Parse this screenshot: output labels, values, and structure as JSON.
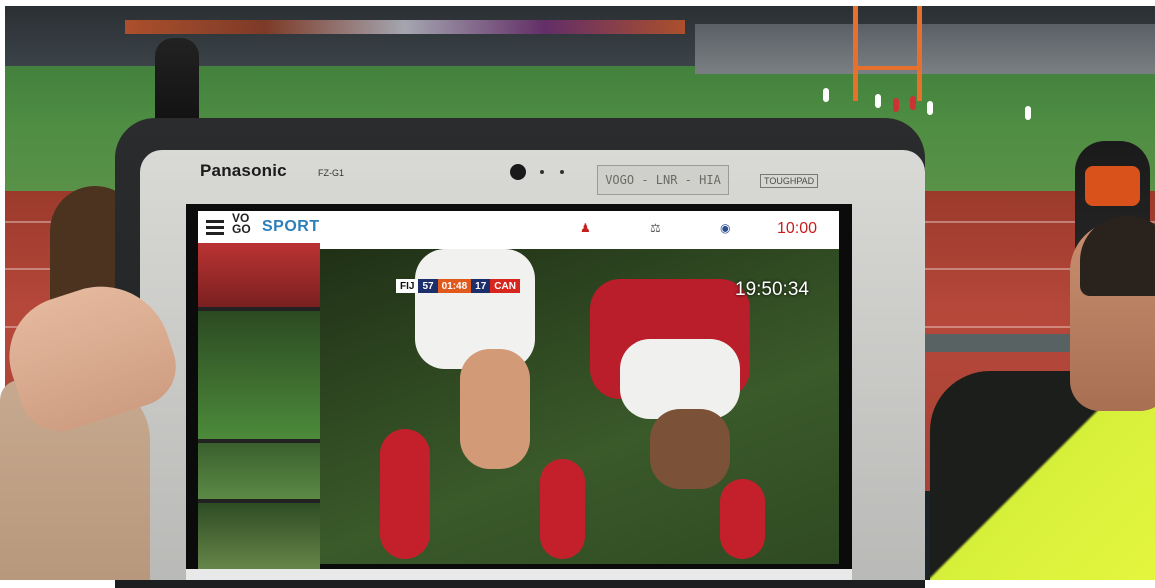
{
  "tablet": {
    "brand": "Panasonic",
    "model": "FZ-G1",
    "label_tape": "VOGO - LNR - HIA",
    "series_badge": "TOUGHPAD"
  },
  "app": {
    "logo_line1": "VO",
    "logo_line2": "GO",
    "logo_sport": "SPORT",
    "time": "10:00"
  },
  "video": {
    "scorebug": {
      "home_team": "FIJ",
      "home_score": "57",
      "match_clock": "01:48",
      "away_score": "17",
      "away_team": "CAN"
    },
    "timestamp": "19:50:34"
  },
  "colors": {
    "accent_blue": "#2d7fb8",
    "time_red": "#c81d1d",
    "scorebug_orange": "#e05a1e",
    "scorebug_navy": "#1d2f6a"
  }
}
